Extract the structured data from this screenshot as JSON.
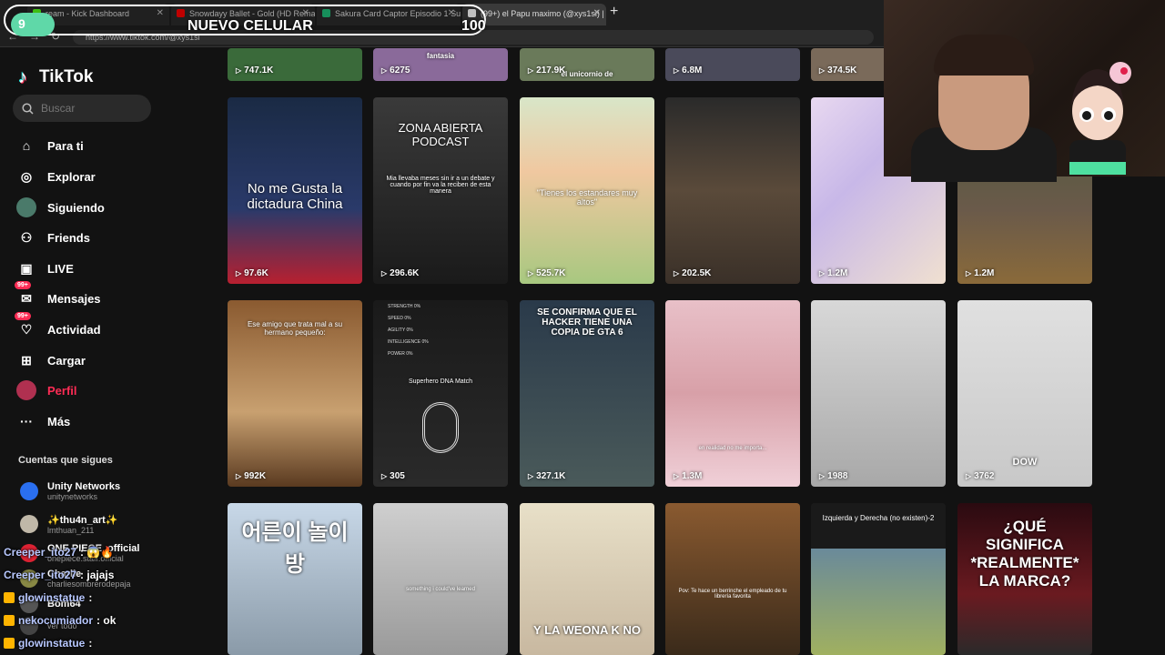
{
  "browser": {
    "tabs": [
      {
        "label": "ream - Kick Dashboard",
        "fav": "#53fc18"
      },
      {
        "label": "Snowdayy Ballet - Gold (HD Remas",
        "fav": "#ff0000"
      },
      {
        "label": "Sakura Card Captor Episodio 1 Sub",
        "fav": "#1fbf7a"
      },
      {
        "label": "(99+) el Papu maximo (@xys1si) | T",
        "fav": "#ffffff"
      }
    ],
    "new_tab_icon": "+",
    "url": "https://www.tiktok.com/@xys1si"
  },
  "overlay": {
    "level": "9",
    "title": "NUEVO CELULAR",
    "count": "100"
  },
  "sidebar": {
    "logo": "TikTok",
    "search_placeholder": "Buscar",
    "items": [
      {
        "label": "Para ti",
        "icon": "home-icon",
        "glyph": "⌂",
        "badge": ""
      },
      {
        "label": "Explorar",
        "icon": "compass-icon",
        "glyph": "◎",
        "badge": ""
      },
      {
        "label": "Siguiendo",
        "icon": "following-avatar-icon",
        "glyph": "●",
        "badge": ""
      },
      {
        "label": "Friends",
        "icon": "friends-icon",
        "glyph": "⚇",
        "badge": ""
      },
      {
        "label": "LIVE",
        "icon": "live-icon",
        "glyph": "▣",
        "badge": ""
      },
      {
        "label": "Mensajes",
        "icon": "messages-icon",
        "glyph": "✉",
        "badge": "99+"
      },
      {
        "label": "Actividad",
        "icon": "activity-icon",
        "glyph": "♡",
        "badge": "99+"
      },
      {
        "label": "Cargar",
        "icon": "upload-icon",
        "glyph": "⊞",
        "badge": ""
      },
      {
        "label": "Perfil",
        "icon": "profile-avatar-icon",
        "glyph": "●",
        "badge": ""
      },
      {
        "label": "Más",
        "icon": "more-icon",
        "glyph": "···",
        "badge": ""
      }
    ],
    "following_title": "Cuentas que sigues",
    "following": [
      {
        "name": "Unity Networks",
        "handle": "unitynetworks",
        "color": "#2a6ff0"
      },
      {
        "name": "✨thu4n_art✨",
        "handle": "lmthuan_211",
        "color": "#c0b8a8"
      },
      {
        "name": "ONE PIECE_official",
        "handle": "onepiece.staff.official",
        "color": "#d23"
      },
      {
        "name": "Charlie",
        "handle": "charliesombrerodepaja",
        "color": "#884"
      },
      {
        "name": "Bom64",
        "handle": "",
        "color": "#555"
      },
      {
        "name": "",
        "handle": "ver todo",
        "color": "#444"
      }
    ]
  },
  "videos_top_row": [
    {
      "views": "747.1K"
    },
    {
      "views": "6275",
      "caption": "fantasia"
    },
    {
      "views": "217.9K",
      "caption": "el unicornio de"
    },
    {
      "views": "6.8M"
    },
    {
      "views": "374.5K"
    }
  ],
  "videos": [
    {
      "views": "97.6K",
      "caption": "No me Gusta la dictadura China"
    },
    {
      "views": "296.6K",
      "caption": "ZONA ABIERTA PODCAST",
      "subcaption": "Mia llevaba meses sin ir a un debate y cuando por fin va la reciben de esta manera"
    },
    {
      "views": "525.7K",
      "caption": "\"Tienes los estandares muy altos\""
    },
    {
      "views": "202.5K"
    },
    {
      "views": "1.2M"
    },
    {
      "views": "1.2M"
    },
    {
      "views": "992K",
      "caption": "Ese amigo que trata mal a su hermano pequeño:"
    },
    {
      "views": "305",
      "caption": "Superhero DNA Match",
      "stats": [
        "STRENGTH 0%",
        "SPEED 0%",
        "AGILITY 0%",
        "INTELLIGENCE 0%",
        "POWER 0%"
      ]
    },
    {
      "views": "327.1K",
      "caption": "SE CONFIRMA QUE EL HACKER TIENE UNA COPIA DE GTA 6"
    },
    {
      "views": "1.3M",
      "caption": "en realidad no me importa..."
    },
    {
      "views": "1988"
    },
    {
      "views": "3762",
      "caption": "DOW"
    },
    {
      "views": "",
      "caption": "어른이 놀이방"
    },
    {
      "views": "",
      "caption": "something i could've learned"
    },
    {
      "views": "",
      "caption": "Y LA WEONA K NO"
    },
    {
      "views": "",
      "caption": "Pov: Te hace un berrinche el empleado de tu librería favorita"
    },
    {
      "views": "",
      "caption": "Izquierda y Derecha (no existen)-2"
    },
    {
      "views": "",
      "caption": "¿QUÉ SIGNIFICA *REALMENTE* LA MARCA?"
    }
  ],
  "chat": [
    {
      "user": "Creeper_ito27",
      "text": ": 😱🔥",
      "icon": "#4a90d9"
    },
    {
      "user": "Creeper_ito27",
      "text": ": jajajs",
      "icon": "#4a90d9"
    },
    {
      "user": "glowinstatue",
      "text": ":",
      "icon": "#ffb400"
    },
    {
      "user": "nekocumiador",
      "text": ": ok",
      "icon": "#ffb400"
    },
    {
      "user": "glowinstatue",
      "text": ":",
      "icon": "#ffb400"
    }
  ],
  "colors": {
    "accent": "#fe2c55",
    "cyan": "#25f4ee"
  }
}
